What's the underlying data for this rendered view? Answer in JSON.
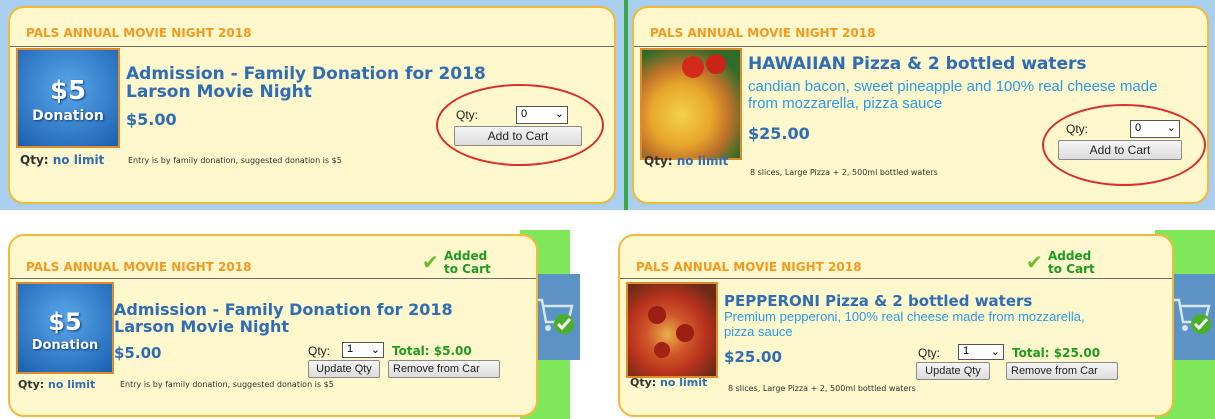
{
  "cards": [
    {
      "header": "PALS ANNUAL MOVIE NIGHT 2018",
      "title": "Admission - Family Donation for 2018 Larson Movie Night",
      "price": "$5.00",
      "qty_label": "Qty:",
      "qty_limit": "no limit",
      "note": "Entry is by family donation, suggested donation is $5",
      "qty_field_label": "Qty:",
      "qty_value": "0",
      "button": "Add to Cart",
      "thumb_text": [
        "$5",
        "Donation"
      ]
    },
    {
      "header": "PALS ANNUAL MOVIE NIGHT 2018",
      "title": "HAWAIIAN Pizza & 2 bottled waters",
      "description": "candian bacon, sweet pineapple and 100% real cheese made from mozzarella, pizza sauce",
      "price": "$25.00",
      "qty_label": "Qty:",
      "qty_limit": "no limit",
      "note": "8 slices, Large Pizza + 2, 500ml bottled waters",
      "qty_field_label": "Qty:",
      "qty_value": "0",
      "button": "Add to Cart"
    },
    {
      "header": "PALS ANNUAL MOVIE NIGHT 2018",
      "added": "Added to Cart",
      "title": "Admission - Family Donation for 2018 Larson Movie Night",
      "price": "$5.00",
      "qty_label": "Qty:",
      "qty_limit": "no limit",
      "note": "Entry is by family donation, suggested donation is $5",
      "qty_field_label": "Qty:",
      "qty_value": "1",
      "total": "Total: $5.00",
      "update_button": "Update Qty",
      "remove_button": "Remove from Car",
      "thumb_text": [
        "$5",
        "Donation"
      ]
    },
    {
      "header": "PALS ANNUAL MOVIE NIGHT 2018",
      "added": "Added to Cart",
      "title": "PEPPERONI Pizza & 2 bottled waters",
      "description": "Premium pepperoni, 100% real cheese made from mozzarella, pizza sauce",
      "price": "$25.00",
      "qty_label": "Qty:",
      "qty_limit": "no limit",
      "note": "8 slices, Large Pizza + 2, 500ml bottled waters",
      "qty_field_label": "Qty:",
      "qty_value": "1",
      "total": "Total: $25.00",
      "update_button": "Update Qty",
      "remove_button": "Remove from Car"
    }
  ],
  "colors": {
    "card_bg": "#fff8cc",
    "card_border": "#f5b83a",
    "header_text": "#f39a1f",
    "title_text": "#2f6db5",
    "desc_text": "#2a9be8",
    "total_text": "#1f9b1f",
    "highlight_circle": "#d9302a",
    "added_bg": "#7ee85a"
  },
  "icons": [
    "checkmark-icon",
    "shopping-cart-icon",
    "dropdown-chevron-icon"
  ]
}
